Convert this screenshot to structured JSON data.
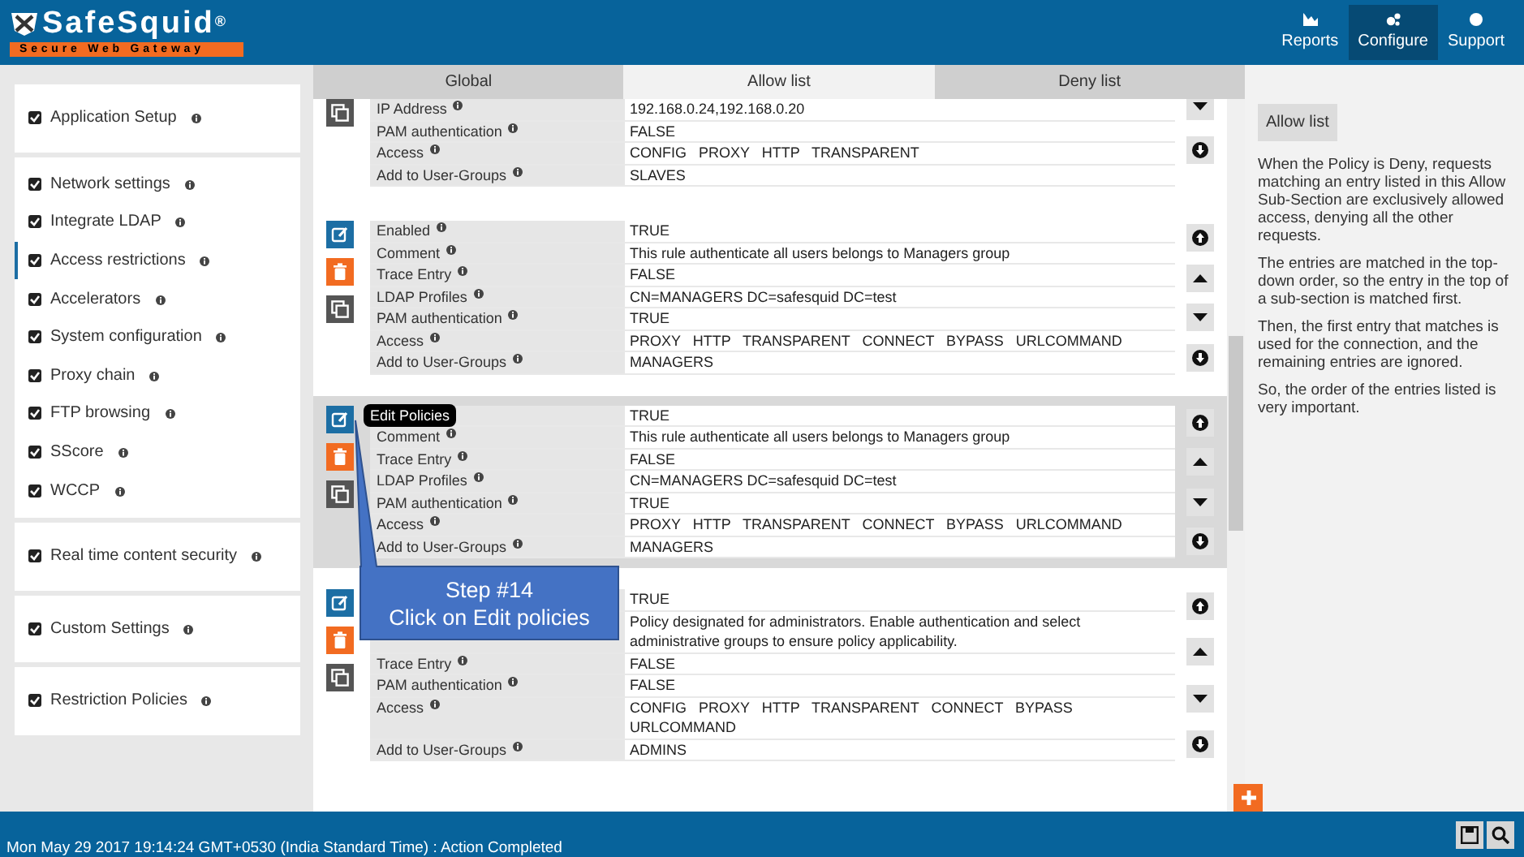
{
  "header": {
    "logo_text": "SafeSquid",
    "logo_mark": "®",
    "tagline": "Secure Web Gateway",
    "nav": [
      {
        "label": "Reports",
        "selected": false
      },
      {
        "label": "Configure",
        "selected": true
      },
      {
        "label": "Support",
        "selected": false
      }
    ]
  },
  "sidebar": {
    "groups": [
      {
        "items": [
          {
            "label": "Application Setup",
            "selected": false
          }
        ]
      },
      {
        "items": [
          {
            "label": "Network settings",
            "selected": false
          },
          {
            "label": "Integrate LDAP",
            "selected": false
          },
          {
            "label": "Access restrictions",
            "selected": true
          },
          {
            "label": "Accelerators",
            "selected": false
          },
          {
            "label": "System configuration",
            "selected": false
          },
          {
            "label": "Proxy chain",
            "selected": false
          },
          {
            "label": "FTP browsing",
            "selected": false
          },
          {
            "label": "SScore",
            "selected": false
          },
          {
            "label": "WCCP",
            "selected": false
          }
        ]
      },
      {
        "items": [
          {
            "label": "Real time content security",
            "selected": false
          }
        ]
      },
      {
        "items": [
          {
            "label": "Custom Settings",
            "selected": false
          }
        ]
      },
      {
        "items": [
          {
            "label": "Restriction Policies",
            "selected": false
          }
        ]
      }
    ]
  },
  "tabs": [
    {
      "label": "Global",
      "selected": false
    },
    {
      "label": "Allow list",
      "selected": true
    },
    {
      "label": "Deny list",
      "selected": false
    }
  ],
  "entries": [
    {
      "cut_top": true,
      "selected": false,
      "rows": [
        {
          "label": "IP Address",
          "value": "192.168.0.24,192.168.0.20"
        },
        {
          "label": "PAM authentication",
          "value": "FALSE"
        },
        {
          "label": "Access",
          "value": "CONFIG   PROXY   HTTP   TRANSPARENT"
        },
        {
          "label": "Add to User-Groups",
          "value": "SLAVES"
        }
      ]
    },
    {
      "cut_top": false,
      "selected": false,
      "rows": [
        {
          "label": "Enabled",
          "value": "TRUE"
        },
        {
          "label": "Comment",
          "value": "This rule authenticate all users belongs to Managers group"
        },
        {
          "label": "Trace Entry",
          "value": "FALSE"
        },
        {
          "label": "LDAP Profiles",
          "value": "CN=MANAGERS DC=safesquid DC=test"
        },
        {
          "label": "PAM authentication",
          "value": "TRUE"
        },
        {
          "label": "Access",
          "value": "PROXY   HTTP   TRANSPARENT   CONNECT   BYPASS   URLCOMMAND"
        },
        {
          "label": "Add to User-Groups",
          "value": "MANAGERS"
        }
      ]
    },
    {
      "cut_top": false,
      "selected": true,
      "tooltip": "Edit Policies",
      "rows": [
        {
          "value": "TRUE"
        },
        {
          "label": "Comment",
          "value": "This rule authenticate all users belongs to Managers group"
        },
        {
          "label": "Trace Entry",
          "value": "FALSE"
        },
        {
          "label": "LDAP Profiles",
          "value": "CN=MANAGERS DC=safesquid DC=test"
        },
        {
          "label": "PAM authentication",
          "value": "TRUE"
        },
        {
          "label": "Access",
          "value": "PROXY   HTTP   TRANSPARENT   CONNECT   BYPASS   URLCOMMAND"
        },
        {
          "label": "Add to User-Groups",
          "value": "MANAGERS"
        }
      ]
    },
    {
      "cut_top": false,
      "selected": false,
      "rows": [
        {
          "value": "TRUE"
        },
        {
          "value": "Policy designated for administrators. Enable authentication and select administrative groups to ensure policy applicability."
        },
        {
          "label": "Trace Entry",
          "value": "FALSE"
        },
        {
          "label": "PAM authentication",
          "value": "FALSE"
        },
        {
          "label": "Access",
          "value": "CONFIG   PROXY   HTTP   TRANSPARENT   CONNECT   BYPASS   URLCOMMAND"
        },
        {
          "label": "Add to User-Groups",
          "value": "ADMINS"
        }
      ]
    }
  ],
  "callout": {
    "lines": [
      "Step #14",
      "Click on Edit policies"
    ]
  },
  "help": {
    "title": "Allow list",
    "paragraphs": [
      "When the Policy is Deny, requests matching an entry listed in this Allow Sub-Section are exclusively allowed access, denying all the other requests.",
      "The entries are matched in the top-down order, so the entry in the top of a sub-section is matched first.",
      "Then, the first entry that matches is used for the connection, and the remaining entries are ignored.",
      "So, the order of the entries listed is very important."
    ]
  },
  "status_bar": {
    "text": "Mon May 29 2017 19:14:24 GMT+0530 (India Standard Time) : Action Completed"
  }
}
